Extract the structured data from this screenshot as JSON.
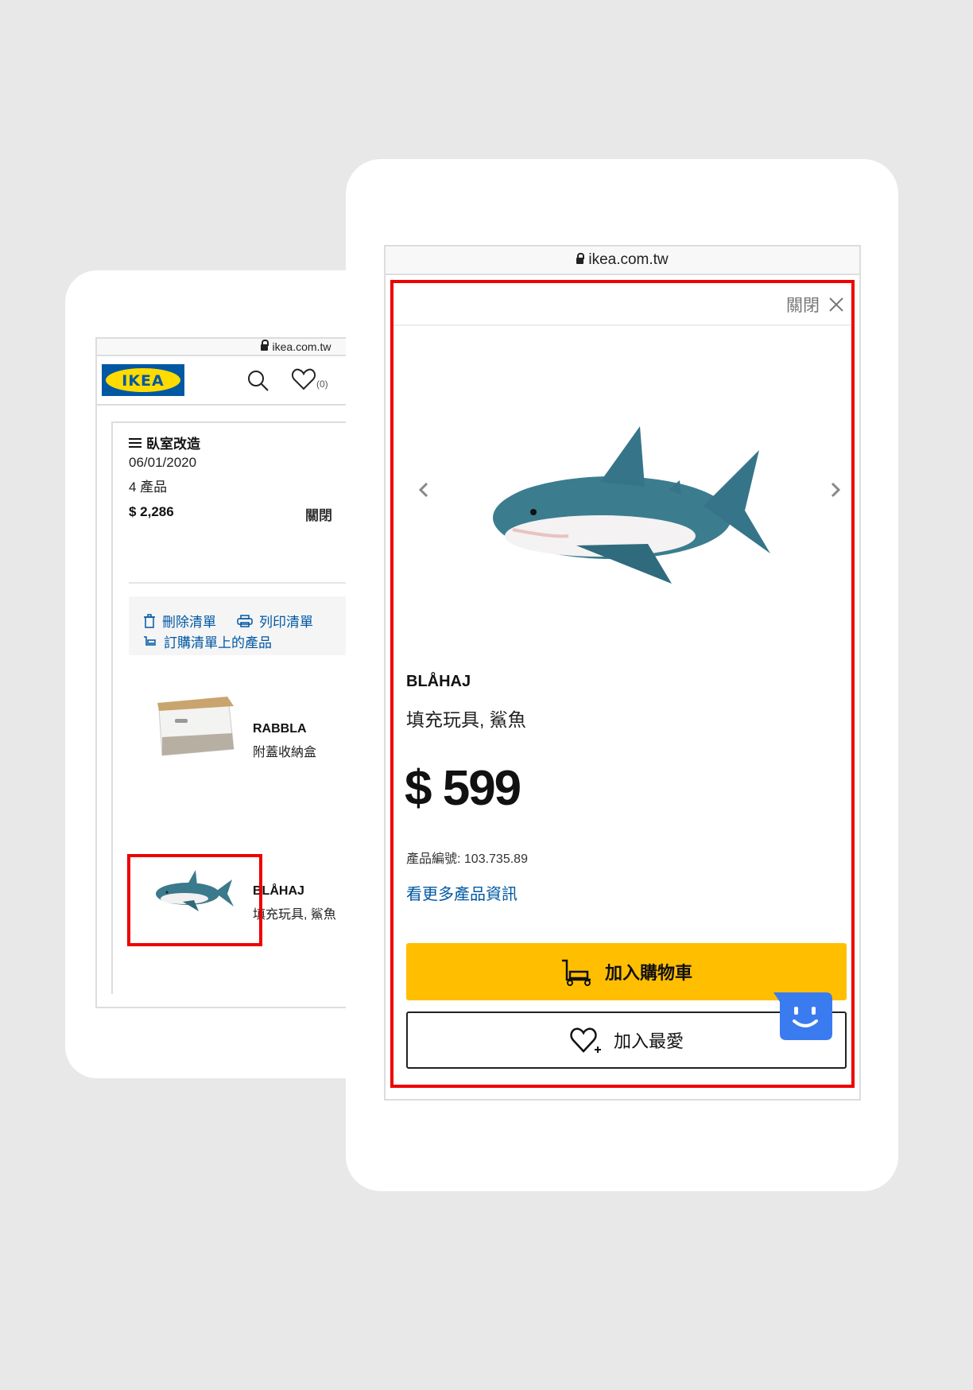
{
  "back": {
    "url": "ikea.com.tw",
    "fav_count": "(0)",
    "list": {
      "title": "臥室改造",
      "date": "06/01/2020",
      "count": "4 產品",
      "total": "$ 2,286",
      "close_partial": "關閉"
    },
    "actions": {
      "delete": "刪除清單",
      "print": "列印清單",
      "order": "訂購清單上的產品"
    },
    "products": [
      {
        "name": "RABBLA",
        "desc": "附蓋收納盒"
      },
      {
        "name": "BLÅHAJ",
        "desc": "填充玩具, 鯊魚"
      }
    ]
  },
  "front": {
    "url": "ikea.com.tw",
    "close_label": "關閉",
    "product": {
      "name": "BLÅHAJ",
      "desc": "填充玩具, 鯊魚",
      "price": "$ 599",
      "article": "產品編號: 103.735.89",
      "more_info": "看更多產品資訊"
    },
    "buttons": {
      "add_cart": "加入購物車",
      "add_fav": "加入最愛"
    }
  },
  "colors": {
    "ikea_blue": "#0058a3",
    "ikea_yellow": "#ffdb00",
    "cart_yellow": "#ffbf00",
    "highlight_red": "#ee0000",
    "chat_blue": "#3b7bf0"
  }
}
